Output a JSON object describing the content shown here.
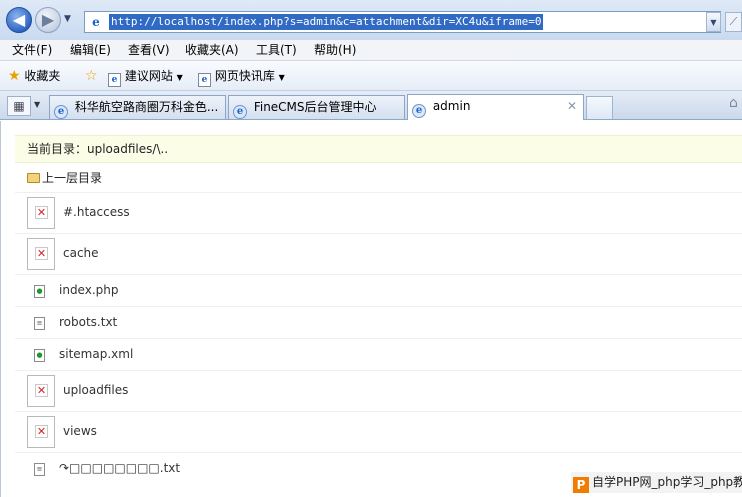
{
  "browser": {
    "url": "http://localhost/index.php?s=admin&c=attachment&dir=XC4u&iframe=0",
    "menu": [
      "文件(F)",
      "编辑(E)",
      "查看(V)",
      "收藏夹(A)",
      "工具(T)",
      "帮助(H)"
    ],
    "favorites": {
      "favorites_label": "收藏夹",
      "suggested_sites": "建议网站",
      "web_slice": "网页快讯库"
    },
    "tabs": [
      {
        "label": "科华航空路商圈万科金色...",
        "active": false
      },
      {
        "label": "FineCMS后台管理中心",
        "active": false
      },
      {
        "label": "admin",
        "active": true
      }
    ]
  },
  "page": {
    "current_dir_label": "当前目录：uploadfiles/\\..",
    "parent_dir_label": "上一层目录",
    "files": [
      {
        "name": "#.htaccess",
        "icon": "broken-image-icon",
        "size": "big"
      },
      {
        "name": "cache",
        "icon": "broken-image-icon",
        "size": "big"
      },
      {
        "name": "index.php",
        "icon": "php-file-icon",
        "size": "small"
      },
      {
        "name": "robots.txt",
        "icon": "text-file-icon",
        "size": "small"
      },
      {
        "name": "sitemap.xml",
        "icon": "php-file-icon",
        "size": "small"
      },
      {
        "name": "uploadfiles",
        "icon": "broken-image-icon",
        "size": "big"
      },
      {
        "name": "views",
        "icon": "broken-image-icon",
        "size": "big"
      },
      {
        "name": "↷□□□□□□□□.txt",
        "icon": "text-file-icon",
        "size": "small"
      }
    ]
  },
  "watermark": {
    "logo": "P",
    "text": "自学PHP网_php学习_php教程"
  }
}
